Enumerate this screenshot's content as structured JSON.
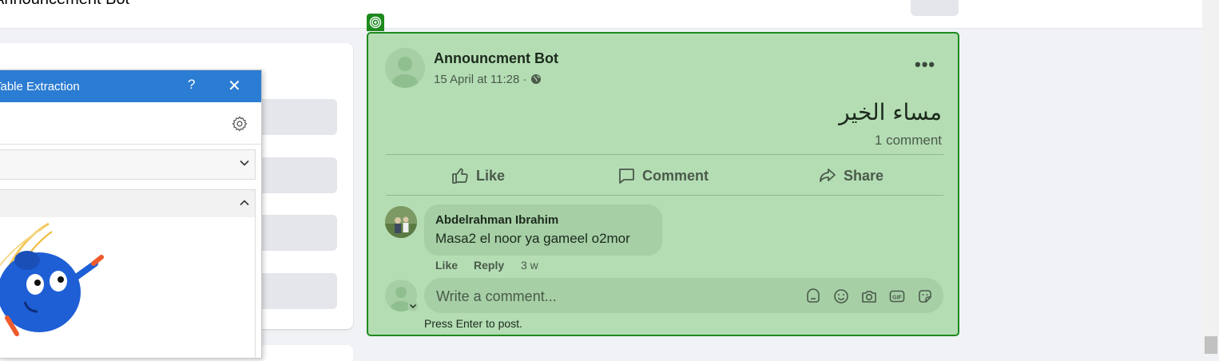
{
  "topbar": {
    "title": "Announcement Bot"
  },
  "extension": {
    "title": "Table Extraction",
    "help_label": "?",
    "close_label": "✕"
  },
  "post": {
    "author": "Announcment Bot",
    "timestamp": "15 April at 11:28 ·",
    "more_label": "•••",
    "text": "مساء الخير",
    "comment_count": "1 comment",
    "actions": {
      "like": "Like",
      "comment": "Comment",
      "share": "Share"
    },
    "comment": {
      "author": "Abdelrahman Ibrahim",
      "text": "Masa2 el noor ya gameel o2mor",
      "like": "Like",
      "reply": "Reply",
      "age": "3 w"
    },
    "composer": {
      "placeholder": "Write a comment...",
      "hint": "Press Enter to post."
    }
  },
  "colors": {
    "highlight_fill": "#b4ddb4",
    "highlight_border": "#1e8a1e",
    "extension_header": "#2b7cd3"
  }
}
